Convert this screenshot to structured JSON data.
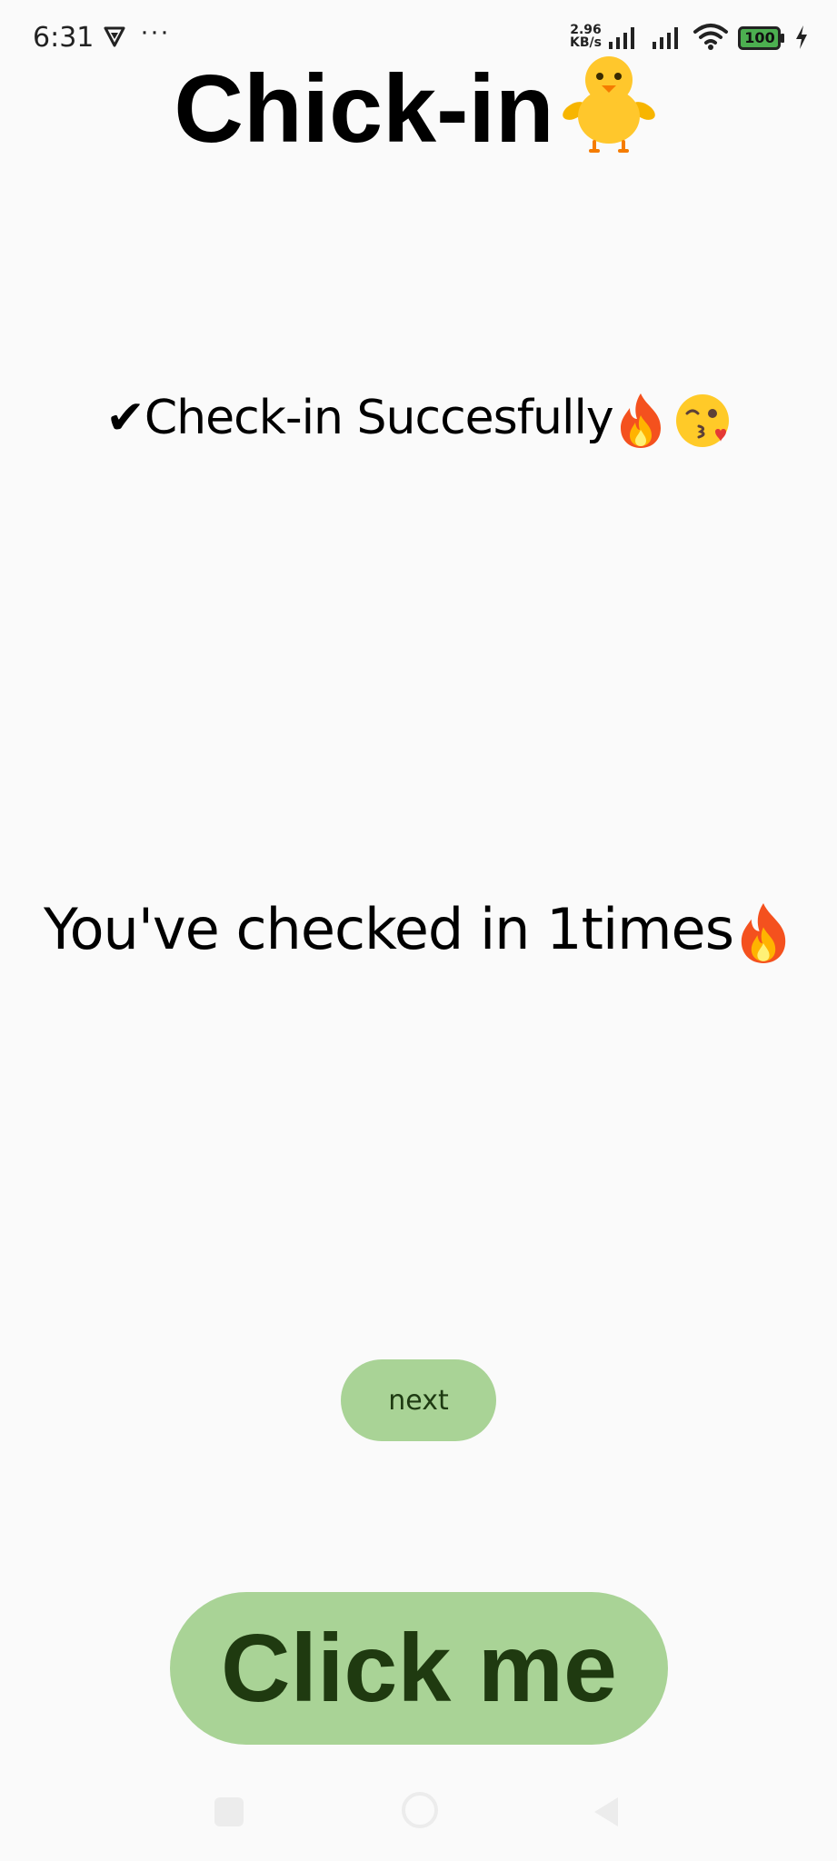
{
  "status_bar": {
    "time": "6:31",
    "more_indicator": "···",
    "net_speed_value": "2.96",
    "net_speed_unit": "KB/s",
    "battery_level": "100",
    "icons": [
      "vpn-icon",
      "signal-icon",
      "wifi-icon",
      "battery-icon",
      "charging-icon"
    ]
  },
  "app": {
    "title": "Chick-in",
    "title_icon": "chick-icon"
  },
  "messages": {
    "success": "✔Check-in Succesfully",
    "success_icons": [
      "fire-icon",
      "kiss-face-icon"
    ],
    "count": "You've checked in 1times",
    "count_icon": "fire-icon"
  },
  "buttons": {
    "next_label": "next",
    "click_label": "Click me"
  },
  "navigation": {
    "icons": [
      "recents-icon",
      "home-icon",
      "back-icon"
    ]
  },
  "colors": {
    "background": "#fafafa",
    "button_fill": "#a9d396",
    "button_text": "#1f3a10"
  }
}
